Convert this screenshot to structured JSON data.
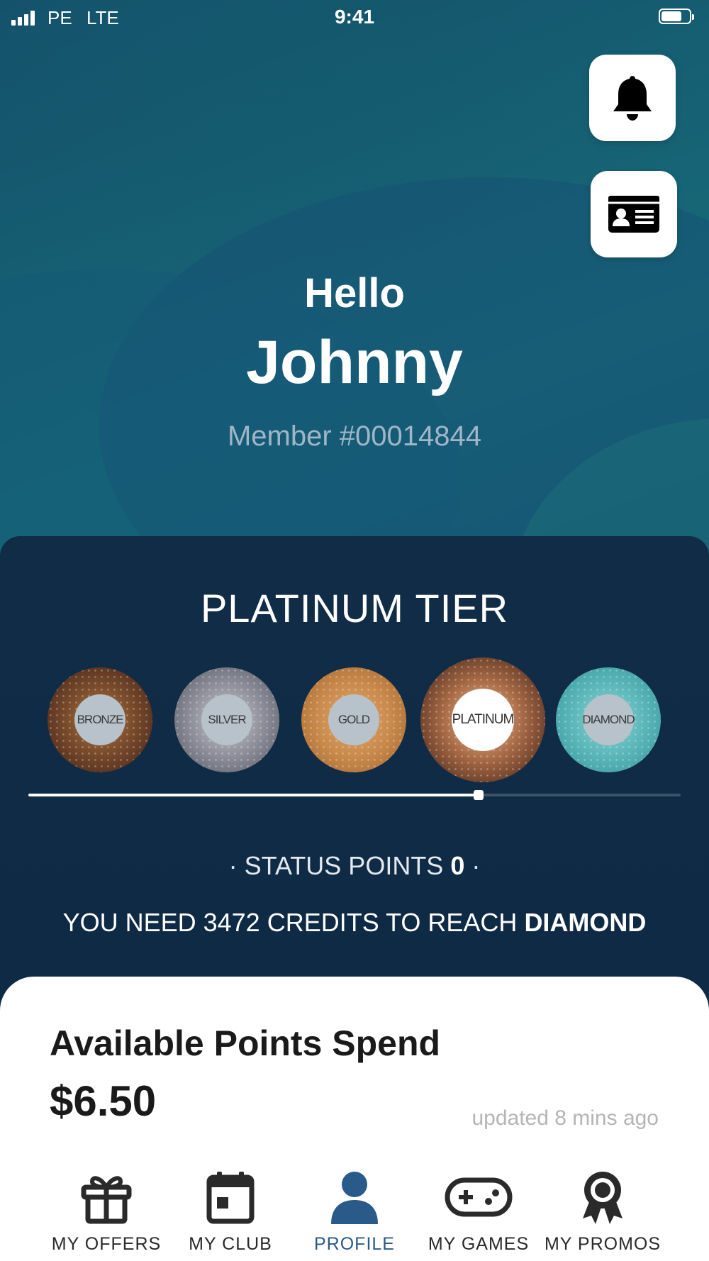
{
  "status_bar": {
    "carrier": "PE",
    "network": "LTE",
    "time": "9:41"
  },
  "header": {
    "greeting": "Hello",
    "name": "Johnny",
    "member": "Member #00014844"
  },
  "tier": {
    "title": "PLATINUM TIER",
    "badges": [
      "BRONZE",
      "SILVER",
      "GOLD",
      "PLATINUM",
      "DIAMOND"
    ],
    "current": "PLATINUM",
    "progress": 0.69,
    "status_points_label": "· STATUS POINTS ",
    "status_points_value": "0",
    "status_points_suffix": " ·",
    "need_text": "YOU NEED 3472 CREDITS TO REACH ",
    "need_target": "DIAMOND"
  },
  "points": {
    "label": "Available Points Spend",
    "value": "$6.50",
    "updated": "updated 8 mins ago"
  },
  "tabs": [
    {
      "label": "MY OFFERS",
      "icon": "gift-icon",
      "active": false
    },
    {
      "label": "MY CLUB",
      "icon": "calendar-icon",
      "active": false
    },
    {
      "label": "PROFILE",
      "icon": "person-icon",
      "active": true
    },
    {
      "label": "MY GAMES",
      "icon": "gamepad-icon",
      "active": false
    },
    {
      "label": "MY PROMOS",
      "icon": "award-icon",
      "active": false
    }
  ],
  "colors": {
    "accent": "#2a5a8a",
    "panel": "#0f2a44",
    "background": "#176b79"
  }
}
